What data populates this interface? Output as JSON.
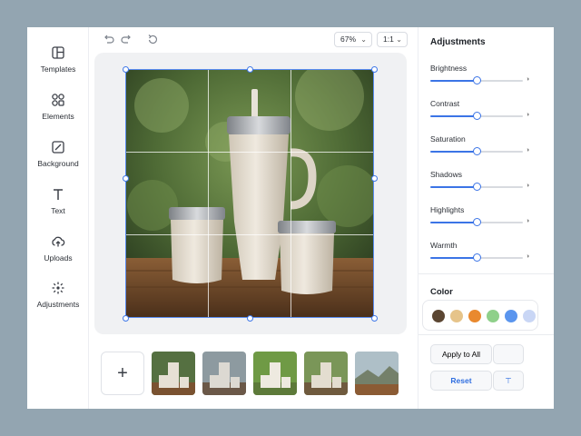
{
  "sidebar": {
    "items": [
      {
        "label": "Templates",
        "icon": "templates-icon"
      },
      {
        "label": "Elements",
        "icon": "elements-icon"
      },
      {
        "label": "Background",
        "icon": "background-icon"
      },
      {
        "label": "Text",
        "icon": "text-icon"
      },
      {
        "label": "Uploads",
        "icon": "uploads-icon"
      },
      {
        "label": "Adjustments",
        "icon": "adjustments-icon"
      }
    ]
  },
  "toolbar": {
    "zoom_value": "67%",
    "ratio_value": "1:1",
    "undo_icon": "undo-icon",
    "redo_icon": "redo-icon",
    "history_icon": "history-icon"
  },
  "adjustments": {
    "title": "Adjustments",
    "sliders": [
      {
        "label": "Brightness",
        "value": 0.5
      },
      {
        "label": "Contrast",
        "value": 0.5
      },
      {
        "label": "Saturation",
        "value": 0.5
      },
      {
        "label": "Shadows",
        "value": 0.5
      },
      {
        "label": "Highlights",
        "value": 0.5
      },
      {
        "label": "Warmth",
        "value": 0.5
      }
    ]
  },
  "color": {
    "title": "Color",
    "swatches": [
      "#5b4632",
      "#e6c48a",
      "#e9892e",
      "#8fd08a",
      "#5a95ee",
      "#c9d6f5"
    ]
  },
  "actions": {
    "apply_all": "Apply to All",
    "reset": "Reset"
  },
  "filmstrip": {
    "add_label": "+",
    "thumbnail_count": 5
  }
}
